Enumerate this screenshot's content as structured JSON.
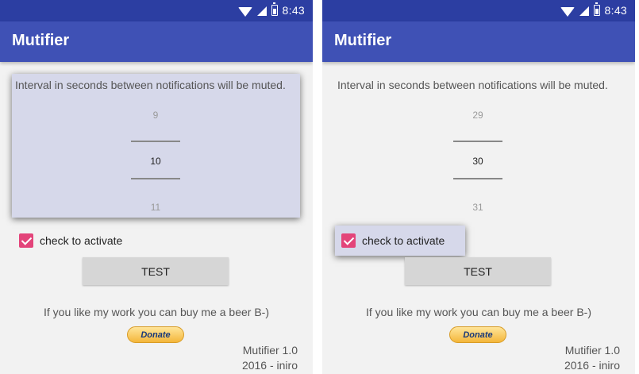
{
  "screens": [
    {
      "status": {
        "time": "8:43"
      },
      "app_title": "Mutifier",
      "interval_label": "Interval in seconds between notifications will be muted.",
      "picker": {
        "previous": "9",
        "current": "10",
        "next": "11"
      },
      "checkbox": {
        "label": "check to activate",
        "checked": true
      },
      "test_button": "TEST",
      "beer_text": "If you like my work you can buy me a beer B-)",
      "donate_button": "Donate",
      "version": "Mutifier 1.0",
      "copyright": "2016 - iniro",
      "focused": "picker"
    },
    {
      "status": {
        "time": "8:43"
      },
      "app_title": "Mutifier",
      "interval_label": "Interval in seconds between notifications will be muted.",
      "picker": {
        "previous": "29",
        "current": "30",
        "next": "31"
      },
      "checkbox": {
        "label": "check to activate",
        "checked": true
      },
      "test_button": "TEST",
      "beer_text": "If you like my work you can buy me a beer B-)",
      "donate_button": "Donate",
      "version": "Mutifier 1.0",
      "copyright": "2016 - iniro",
      "focused": "checkbox"
    }
  ],
  "colors": {
    "status_bar": "#2c3ea2",
    "app_bar": "#3f51b5",
    "checkbox": "#e3447a",
    "focus_highlight": "#d6d8ea"
  }
}
